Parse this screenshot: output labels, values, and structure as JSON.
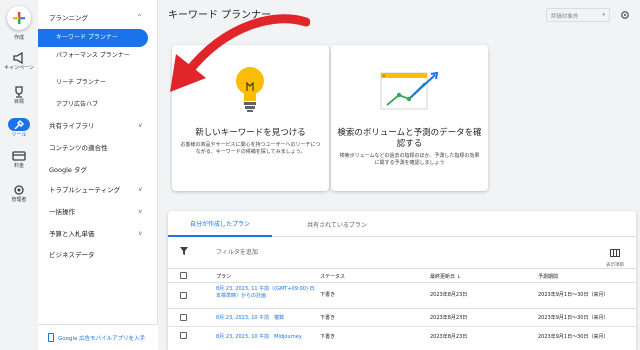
{
  "rail": {
    "items": [
      {
        "label": "作成",
        "icon": "plus-icon"
      },
      {
        "label": "キャンペーン",
        "icon": "megaphone-icon"
      },
      {
        "label": "目標",
        "icon": "trophy-icon"
      },
      {
        "label": "ツール",
        "icon": "tools-icon"
      },
      {
        "label": "料金",
        "icon": "card-icon"
      },
      {
        "label": "管理者",
        "icon": "gear-icon"
      }
    ]
  },
  "sidebar": {
    "planning": "プランニング",
    "sub_items": [
      "キーワード プランナー",
      "パフォーマンス プランナー",
      "リーチ プランナー",
      "アプリ広告ハブ"
    ],
    "items": [
      "共有ライブラリ",
      "コンテンツの適合性",
      "Google タグ",
      "トラブルシューティング",
      "一括操作",
      "予算と入札単価",
      "ビジネスデータ"
    ],
    "footer": "Google 広告モバイルアプリを入手"
  },
  "header": {
    "title": "キーワード プランナー",
    "status_filter": "評価対象外"
  },
  "cards": [
    {
      "title": "新しいキーワードを見つける",
      "desc": "お客様の商品やサービスに関心を持つユーザーへのリーチにつながる、キーワードの候補を探してみましょう。"
    },
    {
      "title": "検索のボリュームと予測のデータを確認する",
      "desc": "検索ボリュームなどの過去の指標のほか、予測した指標の効果に関する予測を確認しましょう"
    }
  ],
  "table": {
    "tabs": [
      "自分が作成したプラン",
      "共有されているプラン"
    ],
    "filter_label": "フィルタを追加",
    "columns_label": "表示項目",
    "headers": [
      "プラン",
      "ステータス",
      "最終更新日",
      "予測期間"
    ],
    "sort_arrow": "↓",
    "rows": [
      {
        "plan": "8月 23, 2023, 11 午前（(GMT+09:00) 日本標準時）からの計画",
        "status": "下書き",
        "updated": "2023年8月23日",
        "period": "2023年9月1日〜30日（来月）"
      },
      {
        "plan": "8月 23, 2023, 10 午前　複数",
        "status": "下書き",
        "updated": "2023年8月23日",
        "period": "2023年9月1日〜30日（来月）"
      },
      {
        "plan": "8月 23, 2023, 10 午前　Midjourney",
        "status": "下書き",
        "updated": "2023年8月23日",
        "period": "2023年9月1日〜30日（来月）"
      }
    ]
  },
  "colors": {
    "accent": "#1a73e8",
    "arrow": "#e0252b",
    "bulb": "#fbbc04"
  }
}
